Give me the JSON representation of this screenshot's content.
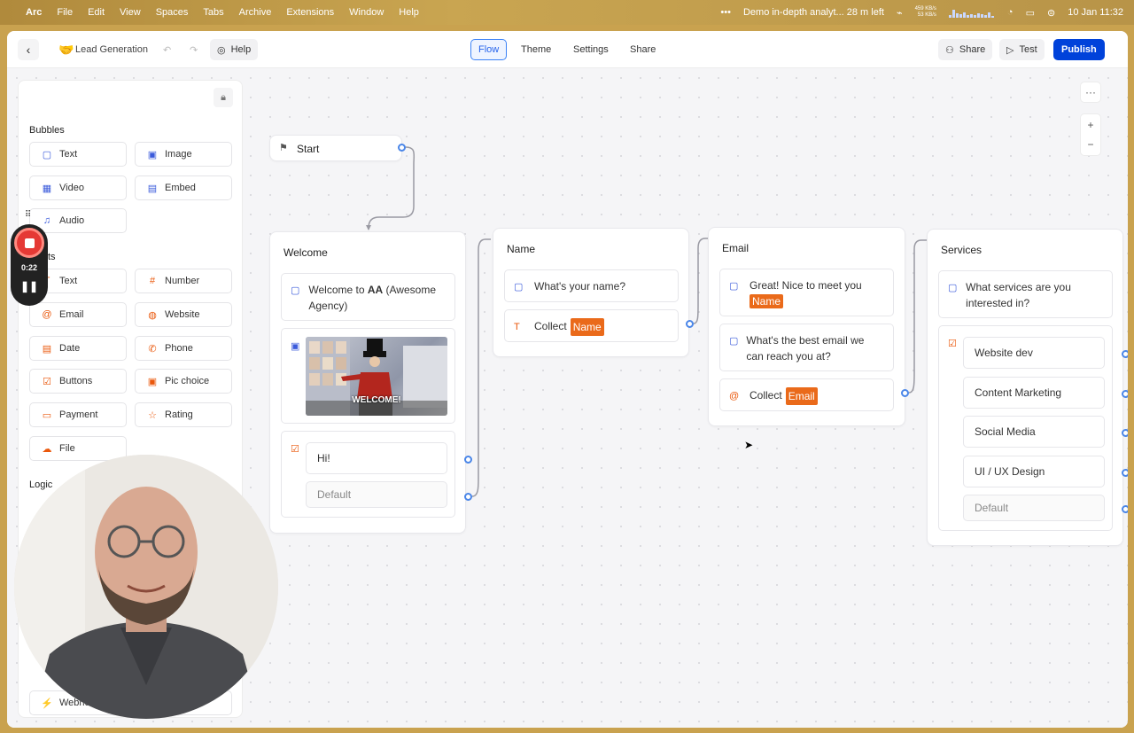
{
  "menubar": {
    "app": "Arc",
    "menus": [
      "File",
      "Edit",
      "View",
      "Spaces",
      "Tabs",
      "Archive",
      "Extensions",
      "Window",
      "Help"
    ],
    "now_playing": "Demo in-depth analyt... 28 m left",
    "net_up": "459 KB/s",
    "net_down": "53 KB/s",
    "datetime": "10 Jan  11:32"
  },
  "topbar": {
    "project_name": "Lead Generation",
    "help": "Help",
    "tabs": [
      "Flow",
      "Theme",
      "Settings",
      "Share"
    ],
    "share": "Share",
    "test": "Test",
    "publish": "Publish"
  },
  "sidebar": {
    "bubbles_title": "Bubbles",
    "bubbles": [
      "Text",
      "Image",
      "Video",
      "Embed",
      "Audio"
    ],
    "inputs_title": "ts",
    "inputs": [
      "Text",
      "Number",
      "Email",
      "Website",
      "Date",
      "Phone",
      "Buttons",
      "Pic choice",
      "Payment",
      "Rating",
      "File"
    ],
    "logic_title": "Logic",
    "webhook_partial": "Webhoo"
  },
  "recorder": {
    "time": "0:22"
  },
  "flow": {
    "start": {
      "title": "Start"
    },
    "welcome": {
      "title": "Welcome",
      "text_pre": "Welcome to ",
      "text_bold": "AA",
      "text_post": " (Awesome Agency)",
      "gif_caption": "WELCOME!",
      "button_1": "Hi!",
      "button_default": "Default"
    },
    "name": {
      "title": "Name",
      "question": "What's your name?",
      "collect_label": "Collect",
      "collect_var": "Name"
    },
    "email": {
      "title": "Email",
      "greeting_pre": "Great! Nice to meet you",
      "greeting_var": "Name",
      "question": "What's the best email we can reach you at?",
      "collect_label": "Collect",
      "collect_var": "Email"
    },
    "services": {
      "title": "Services",
      "question": "What services are you interested in?",
      "options": [
        "Website dev",
        "Content Marketing",
        "Social Media",
        "UI / UX Design"
      ],
      "default": "Default"
    }
  },
  "canvas_controls": {
    "more": "···",
    "zoom_in": "+",
    "zoom_out": "−"
  },
  "icons": [
    "apple-icon",
    "back-icon",
    "undo-icon",
    "redo-icon",
    "help-icon",
    "lock-icon",
    "message-icon",
    "image-icon",
    "video-icon",
    "embed-icon",
    "audio-icon",
    "flag-icon",
    "checkbox-icon",
    "text-input-icon",
    "at-icon",
    "cursor-icon"
  ]
}
